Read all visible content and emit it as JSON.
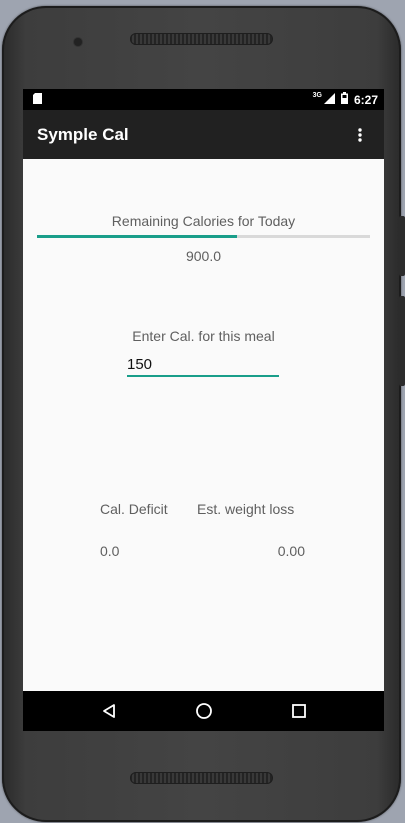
{
  "status_bar": {
    "time": "6:27",
    "network_label": "3G",
    "icons": [
      "sd-card-icon",
      "signal-icon",
      "battery-icon"
    ]
  },
  "app_bar": {
    "title": "Symple Cal",
    "menu_icon": "overflow-menu-icon"
  },
  "main": {
    "remaining_label": "Remaining Calories for Today",
    "remaining_value": "900.0",
    "progress_fraction": 0.6,
    "enter_label": "Enter Cal. for this meal",
    "meal_input_value": "150",
    "deficit_label": "Cal. Deficit",
    "weight_label": "Est. weight loss",
    "deficit_value": "0.0",
    "weight_value": "0.00"
  },
  "nav_bar": {
    "icons": [
      "back-icon",
      "home-icon",
      "recents-icon"
    ]
  },
  "colors": {
    "accent": "#199e8a",
    "app_bar": "#212121",
    "background": "#fafafa"
  }
}
